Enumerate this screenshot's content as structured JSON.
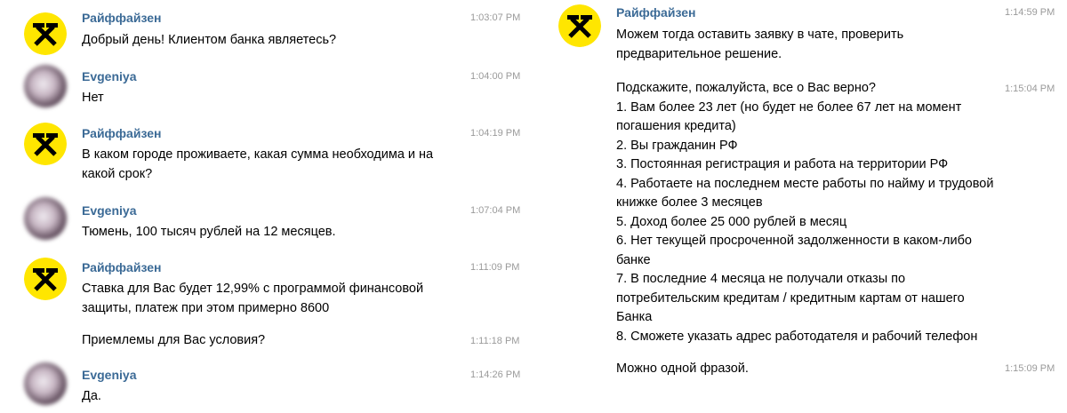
{
  "chat": {
    "left": [
      {
        "sender": "Райффайзен",
        "avatar": "raiffeisen-logo",
        "time": "1:03:07 PM",
        "lines": [
          "Добрый день! Клиентом банка являетесь?"
        ]
      },
      {
        "sender": "Evgeniya",
        "avatar": "user-photo-blurred",
        "time": "1:04:00 PM",
        "lines": [
          "Нет"
        ]
      },
      {
        "sender": "Райффайзен",
        "avatar": "raiffeisen-logo",
        "time": "1:04:19 PM",
        "lines": [
          "В каком городе проживаете, какая сумма необходима и на",
          "какой срок?"
        ]
      },
      {
        "sender": "Evgeniya",
        "avatar": "user-photo-blurred",
        "time": "1:07:04 PM",
        "lines": [
          "Тюмень, 100 тысяч рублей на 12 месяцев."
        ]
      },
      {
        "sender": "Райффайзен",
        "avatar": "raiffeisen-logo",
        "time": "1:11:09 PM",
        "lines": [
          "Ставка для Вас будет 12,99% с программой финансовой",
          "защиты, платеж при этом примерно 8600"
        ]
      },
      {
        "time": "1:11:18 PM",
        "lines": [
          "Приемлемы для Вас условия?"
        ]
      },
      {
        "sender": "Evgeniya",
        "avatar": "user-photo-blurred",
        "time": "1:14:26 PM",
        "lines": [
          "Да."
        ]
      }
    ],
    "right": [
      {
        "sender": "Райффайзен",
        "avatar": "raiffeisen-logo",
        "time": "1:14:59 PM",
        "lines": [
          "Можем тогда оставить заявку в чате, проверить",
          "предварительное решение."
        ]
      },
      {
        "time": "1:15:04 PM",
        "lines": [
          "Подскажите, пожалуйста, все о Вас верно?",
          "1. Вам более 23 лет (но будет не более 67 лет на момент",
          "погашения кредита)",
          "2. Вы гражданин РФ",
          "3. Постоянная регистрация и работа на территории РФ",
          "4. Работаете на последнем месте работы по найму и трудовой",
          "книжке более 3 месяцев",
          "5. Доход более 25 000 рублей в месяц",
          "6. Нет текущей просроченной задолженности в каком-либо",
          "банке",
          "7. В последние 4 месяца не получали отказы по",
          "потребительским кредитам / кредитным картам от нашего",
          "Банка",
          "8. Сможете указать адрес работодателя и рабочий телефон"
        ]
      },
      {
        "time": "1:15:09 PM",
        "lines": [
          "Можно одной фразой."
        ]
      }
    ]
  },
  "colors": {
    "sender": "#3b6a96",
    "time": "#9a9a9a",
    "logo_yellow": "#ffe600",
    "logo_black": "#000000"
  }
}
